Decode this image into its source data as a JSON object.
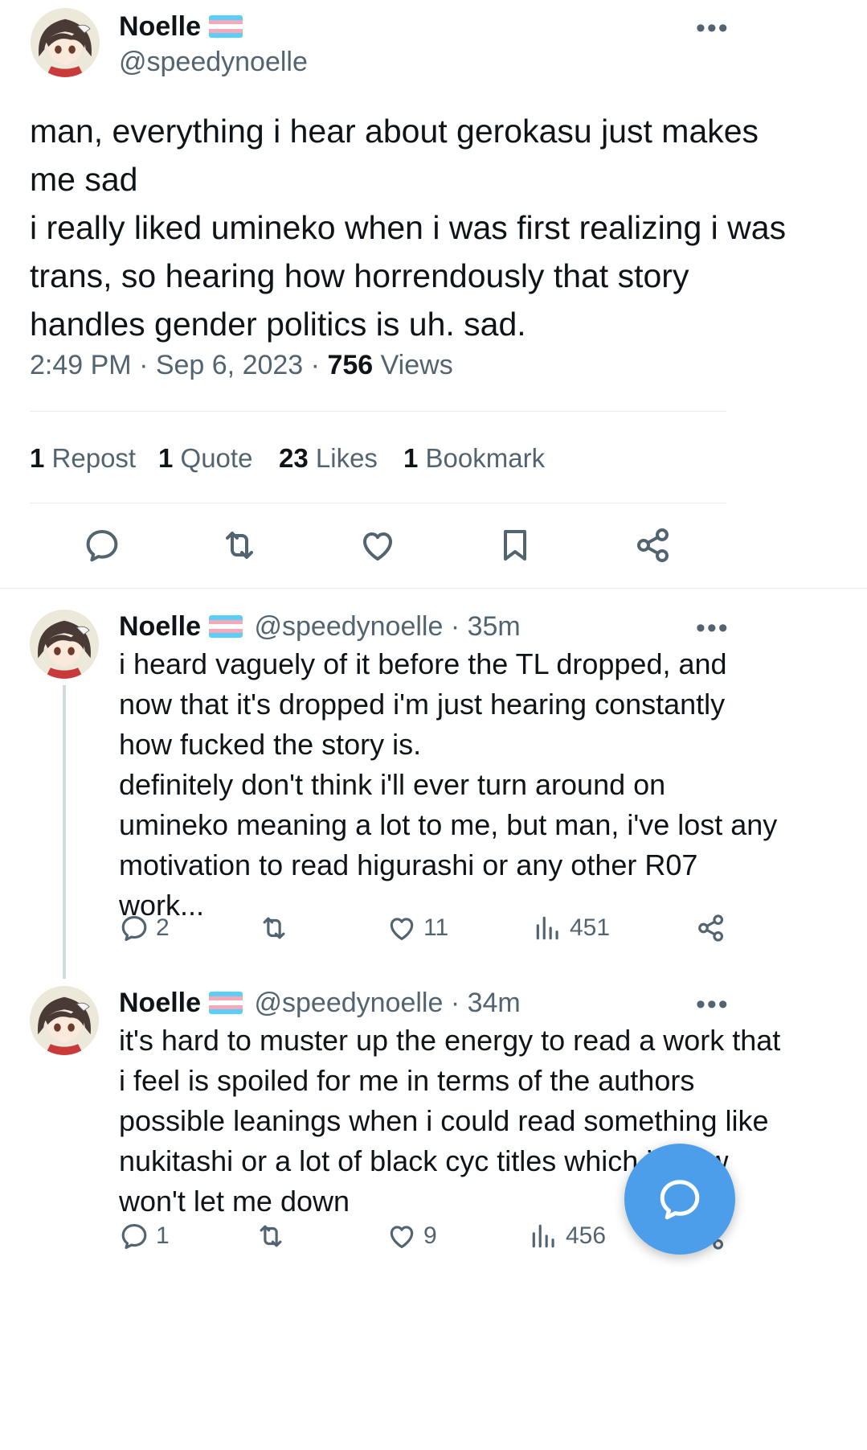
{
  "tweet": {
    "name": "Noelle",
    "handle": "@speedynoelle",
    "more": "•••",
    "text": "man, everything i hear about gerokasu just makes\nme sad\ni really liked umineko when i was first realizing i was\ntrans, so hearing how horrendously that story\nhandles gender politics is uh. sad.",
    "time": "2:49 PM · Sep 6, 2023 · ",
    "views_count": "756",
    "views_label": " Views",
    "stats": {
      "repost_count": "1",
      "repost_label": " Repost",
      "quote_count": "1",
      "quote_label": " Quote",
      "likes_count": "23",
      "likes_label": " Likes",
      "bookmark_count": "1",
      "bookmark_label": " Bookmark"
    }
  },
  "replies": [
    {
      "name": "Noelle",
      "handle": "@speedynoelle · 35m",
      "more": "•••",
      "text": "i heard vaguely of it before the TL dropped, and\nnow that it's dropped i'm just hearing constantly\nhow fucked the story is.\ndefinitely don't think i'll ever turn around on\numineko meaning a lot to me, but man, i've lost any\nmotivation to read higurashi or any other R07\nwork...",
      "replies": "2",
      "reposts": "",
      "likes": "11",
      "views": "451"
    },
    {
      "name": "Noelle",
      "handle": "@speedynoelle · 34m",
      "more": "•••",
      "text": "it's hard to muster up the energy to read a work that\ni feel is spoiled for me in terms of the authors\npossible leanings when i could read something like\nnukitashi or a lot of black cyc titles which i know\nwon't let me down",
      "replies": "1",
      "reposts": "",
      "likes": "9",
      "views": "456"
    }
  ],
  "icons": {
    "reply": "reply-icon",
    "repost": "repost-icon",
    "like": "heart-icon",
    "bookmark": "bookmark-icon",
    "share": "share-icon",
    "views": "views-icon",
    "compose": "compose-icon"
  },
  "colors": {
    "accent": "#4c9eeb",
    "text": "#0f1419",
    "secondary": "#536471",
    "flag_blue": "#5bcefa",
    "flag_pink": "#f5a9b8"
  }
}
